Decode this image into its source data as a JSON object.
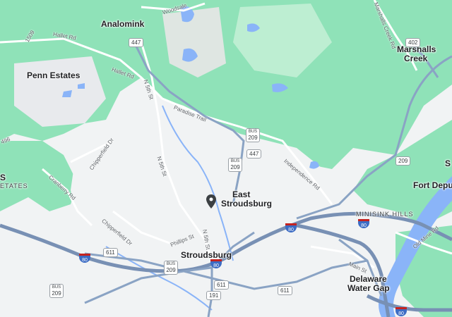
{
  "map": {
    "colors": {
      "land": "#f1f3f4",
      "forest": "#8fe2b8",
      "forest_light": "#bdeed2",
      "water": "#8ab4f8",
      "highway": "#8aa3c4",
      "road": "#ffffff",
      "interstate_shield": "#3c6cc4"
    },
    "places": {
      "analomink": "Analomink",
      "penn_estates": "Penn Estates",
      "marshalls_creek_1": "Marshalls",
      "marshalls_creek_2": "Creek",
      "east_stroudsburg_1": "East",
      "east_stroudsburg_2": "Stroudsburg",
      "stroudsburg": "Stroudsburg",
      "fort_depuy": "Fort Depuy",
      "minisink_hills": "MINISINK HILLS",
      "delaware_water_gap_1": "Delaware",
      "delaware_water_gap_2": "Water Gap",
      "edge_estates": "ETATES",
      "edge_s": "S",
      "edge_sh": "S"
    },
    "roads": {
      "woodside": "Woodsale",
      "hallet_1": "Hallet Rd",
      "hallet_2": "Hallet Rd",
      "n5th_1": "N 5th St",
      "n5th_2": "N 5th St",
      "n5th_3": "N 5th St",
      "paradise_trail": "Paradise Trail",
      "chipperfield_1": "Chipperfield Dr",
      "chipperfield_2": "Chipperfield Dr",
      "cranberry": "Cranberry Rd",
      "independence": "Independence Rd",
      "phillips": "Phillips St",
      "marshalls_creek_rd": "Marshalls Creek Rd",
      "old_mine": "Old Mine Rd",
      "main_st": "Main St",
      "r496": "496",
      "r509": "1509"
    },
    "shields": {
      "r447_top": "447",
      "r447_mid": "447",
      "r402": "402",
      "r209_east": "209",
      "r611_left": "611",
      "r611_center": "611",
      "r611_right": "611",
      "r191": "191"
    },
    "bus_routes": {
      "bus_label": "BUS",
      "b209_a": "209",
      "b209_b": "209",
      "b209_c": "209",
      "b209_d": "209"
    },
    "interstates": {
      "i80_a": "80",
      "i80_b": "80",
      "i80_c": "80",
      "i80_d": "80",
      "i80_e": "80"
    }
  }
}
